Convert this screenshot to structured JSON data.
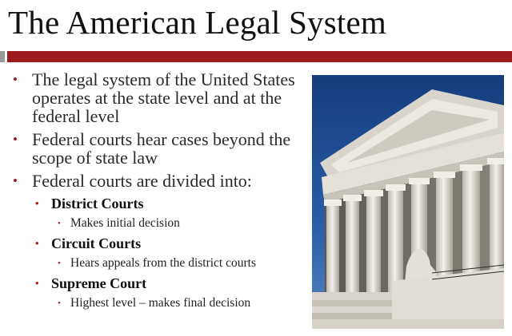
{
  "slide": {
    "title": "The American Legal System",
    "bullets": [
      {
        "text": "The legal system of the United States operates at the state level and at the federal level"
      },
      {
        "text": "Federal courts hear cases beyond the scope of state law"
      },
      {
        "text": "Federal courts are divided into:"
      }
    ],
    "courts": [
      {
        "name": "District Courts",
        "detail": "Makes initial decision"
      },
      {
        "name": "Circuit Courts",
        "detail": "Hears appeals from the district courts"
      },
      {
        "name": "Supreme Court",
        "detail": "Highest level – makes final decision"
      }
    ],
    "bullet_glyph": "•"
  },
  "colors": {
    "accent_bar": "#9e1b1b",
    "bullet": "#a21c1c",
    "sky": "#1f4f9a",
    "marble": "#e9e6df"
  },
  "image": {
    "subject": "supreme-court-building-photo"
  }
}
